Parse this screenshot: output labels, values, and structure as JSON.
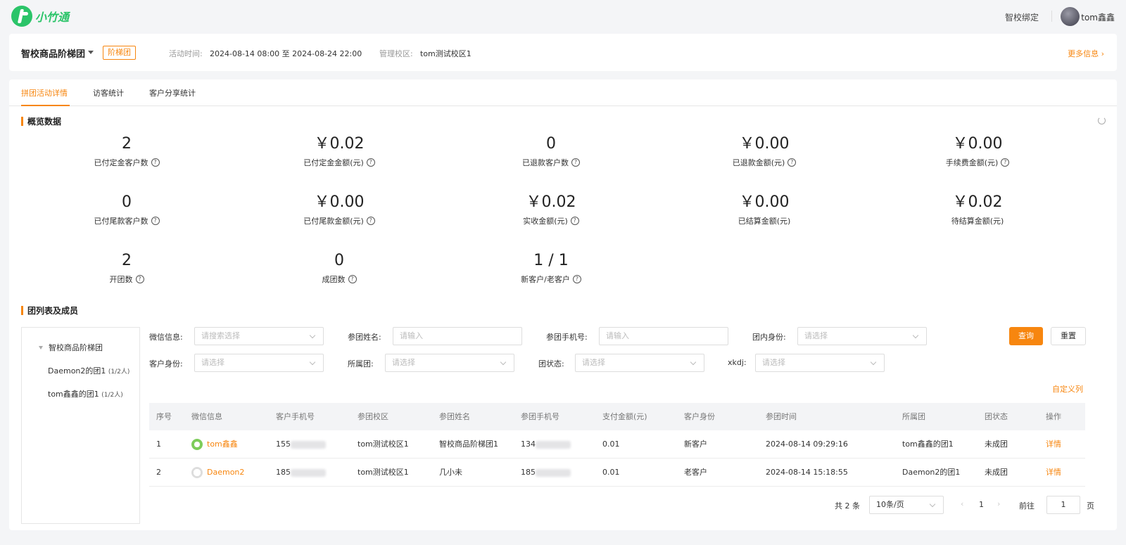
{
  "header": {
    "brand": "小竹通",
    "bind_link": "智校绑定",
    "username": "tom鑫鑫"
  },
  "activity": {
    "name": "智校商品阶梯团",
    "tag": "阶梯团",
    "time_label": "活动时间:",
    "time_value": "2024-08-14 08:00 至 2024-08-24 22:00",
    "campus_label": "管理校区:",
    "campus_value": "tom测试校区1",
    "more_info": "更多信息"
  },
  "tabs": [
    "拼团活动详情",
    "访客统计",
    "客户分享统计"
  ],
  "overview": {
    "title": "概览数据",
    "stats": [
      {
        "value": "2",
        "label": "已付定金客户数",
        "help": true
      },
      {
        "value": "￥0.02",
        "label": "已付定金金额(元)",
        "help": true
      },
      {
        "value": "0",
        "label": "已退款客户数",
        "help": true
      },
      {
        "value": "￥0.00",
        "label": "已退款金额(元)",
        "help": true
      },
      {
        "value": "￥0.00",
        "label": "手续费金额(元)",
        "help": true
      },
      {
        "value": "0",
        "label": "已付尾款客户数",
        "help": true
      },
      {
        "value": "￥0.00",
        "label": "已付尾款金额(元)",
        "help": true
      },
      {
        "value": "￥0.02",
        "label": "实收金额(元)",
        "help": true
      },
      {
        "value": "￥0.00",
        "label": "已结算金额(元)",
        "help": false
      },
      {
        "value": "￥0.02",
        "label": "待结算金额(元)",
        "help": false
      },
      {
        "value": "2",
        "label": "开团数",
        "help": true
      },
      {
        "value": "0",
        "label": "成团数",
        "help": true
      },
      {
        "value": "1 / 1",
        "label": "新客户/老客户",
        "help": true
      }
    ]
  },
  "groups": {
    "title": "团列表及成员",
    "tree": {
      "root": "智校商品阶梯团",
      "children": [
        {
          "name": "Daemon2的团1",
          "count": "(1/2人)"
        },
        {
          "name": "tom鑫鑫的团1",
          "count": "(1/2人)"
        }
      ]
    },
    "filters": {
      "wechat_label": "微信信息:",
      "wechat_placeholder": "请搜索选择",
      "name_label": "参团姓名:",
      "name_placeholder": "请输入",
      "phone_label": "参团手机号:",
      "phone_placeholder": "请输入",
      "role_label": "团内身份:",
      "role_placeholder": "请选择",
      "customer_label": "客户身份:",
      "customer_placeholder": "请选择",
      "group_label": "所属团:",
      "group_placeholder": "请选择",
      "status_label": "团状态:",
      "status_placeholder": "请选择",
      "xkdj_label": "xkdj:",
      "xkdj_placeholder": "请选择",
      "search": "查询",
      "reset": "重置",
      "custom_columns": "自定义列"
    },
    "columns": [
      "序号",
      "微信信息",
      "客户手机号",
      "参团校区",
      "参团姓名",
      "参团手机号",
      "支付金额(元)",
      "客户身份",
      "参团时间",
      "所属团",
      "团状态",
      "操作"
    ],
    "rows": [
      {
        "no": "1",
        "wechat": "tom鑫鑫",
        "phone": "155",
        "campus": "tom测试校区1",
        "name": "智校商品阶梯团1",
        "join_phone": "134",
        "amount": "0.01",
        "customer": "新客户",
        "time": "2024-08-14 09:29:16",
        "group": "tom鑫鑫的团1",
        "status": "未成团",
        "action": "详情"
      },
      {
        "no": "2",
        "wechat": "Daemon2",
        "phone": "185",
        "campus": "tom测试校区1",
        "name": "几小未",
        "join_phone": "185",
        "amount": "0.01",
        "customer": "老客户",
        "time": "2024-08-14 15:18:55",
        "group": "Daemon2的团1",
        "status": "未成团",
        "action": "详情"
      }
    ],
    "pagination": {
      "total": "共 2 条",
      "page_size": "10条/页",
      "current": "1",
      "goto_label": "前往",
      "goto_value": "1",
      "page_unit": "页"
    }
  },
  "colors": {
    "accent": "#f7860f",
    "brand": "#2bc469"
  }
}
